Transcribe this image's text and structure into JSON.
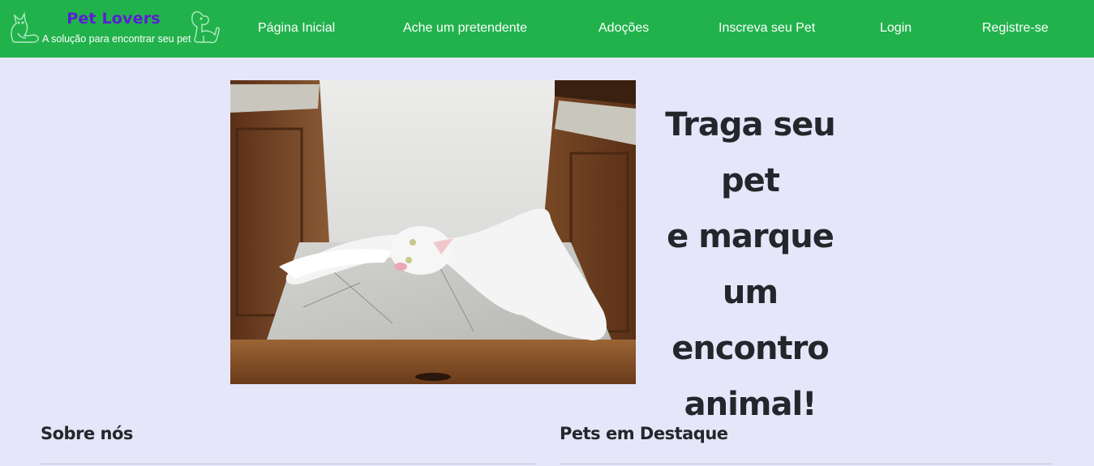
{
  "brand": {
    "title": "Pet Lovers",
    "subtitle": "A solução para encontrar seu pet",
    "left_icon": "cat-outline-icon",
    "right_icon": "dog-outline-icon"
  },
  "nav": {
    "home": "Página Inicial",
    "find_match": "Ache um pretendente",
    "adoptions": "Adoções",
    "register_pet": "Inscreva seu Pet",
    "login": "Login",
    "signup": "Registre-se"
  },
  "hero": {
    "image": "white-cat-lying-on-marble-shelf-photo",
    "line1": "Traga seu pet",
    "line2": "e marque um",
    "line3": "encontro",
    "line4": "animal!"
  },
  "sections": {
    "about_title": "Sobre nós",
    "featured_title": "Pets em Destaque"
  },
  "colors": {
    "navbar": "#22b24c",
    "background": "#e6e6fa",
    "brand_title": "#5b1ed3",
    "text": "#25262b"
  }
}
